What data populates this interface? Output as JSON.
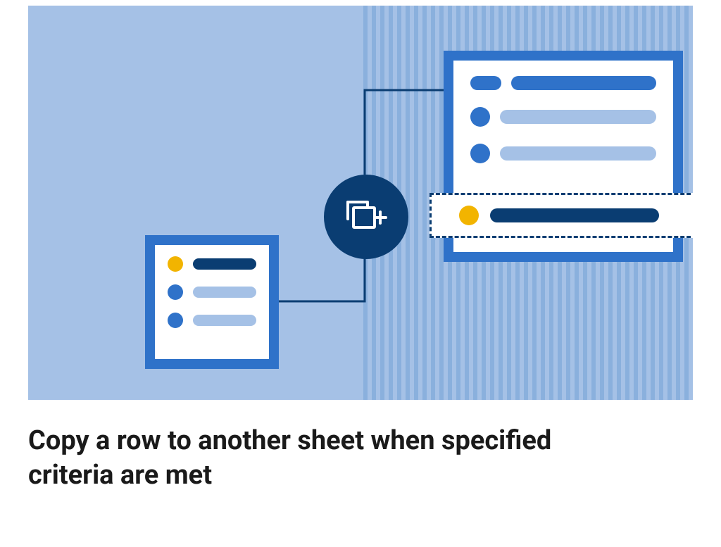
{
  "title": "Copy a row to another sheet when specified criteria are met",
  "icon_name": "copy-add-icon",
  "colors": {
    "bg_light": "#a5c1e6",
    "bg_stripe": "#8ab0dd",
    "frame_blue": "#2f72c9",
    "dark_blue": "#0a3d72",
    "yellow": "#f2b400",
    "light_row": "#a5c1e6"
  },
  "diagram": {
    "source_sheet_rows": [
      {
        "dot": "yellow",
        "bar": "dark"
      },
      {
        "dot": "blue",
        "bar": "light"
      },
      {
        "dot": "blue",
        "bar": "light"
      }
    ],
    "dest_sheet_rows": [
      {
        "pill": "blue",
        "bar": "blue"
      },
      {
        "dot": "blue",
        "bar": "light"
      },
      {
        "dot": "blue",
        "bar": "light"
      }
    ],
    "inserted_row": {
      "dot": "yellow",
      "bar": "dark"
    }
  }
}
